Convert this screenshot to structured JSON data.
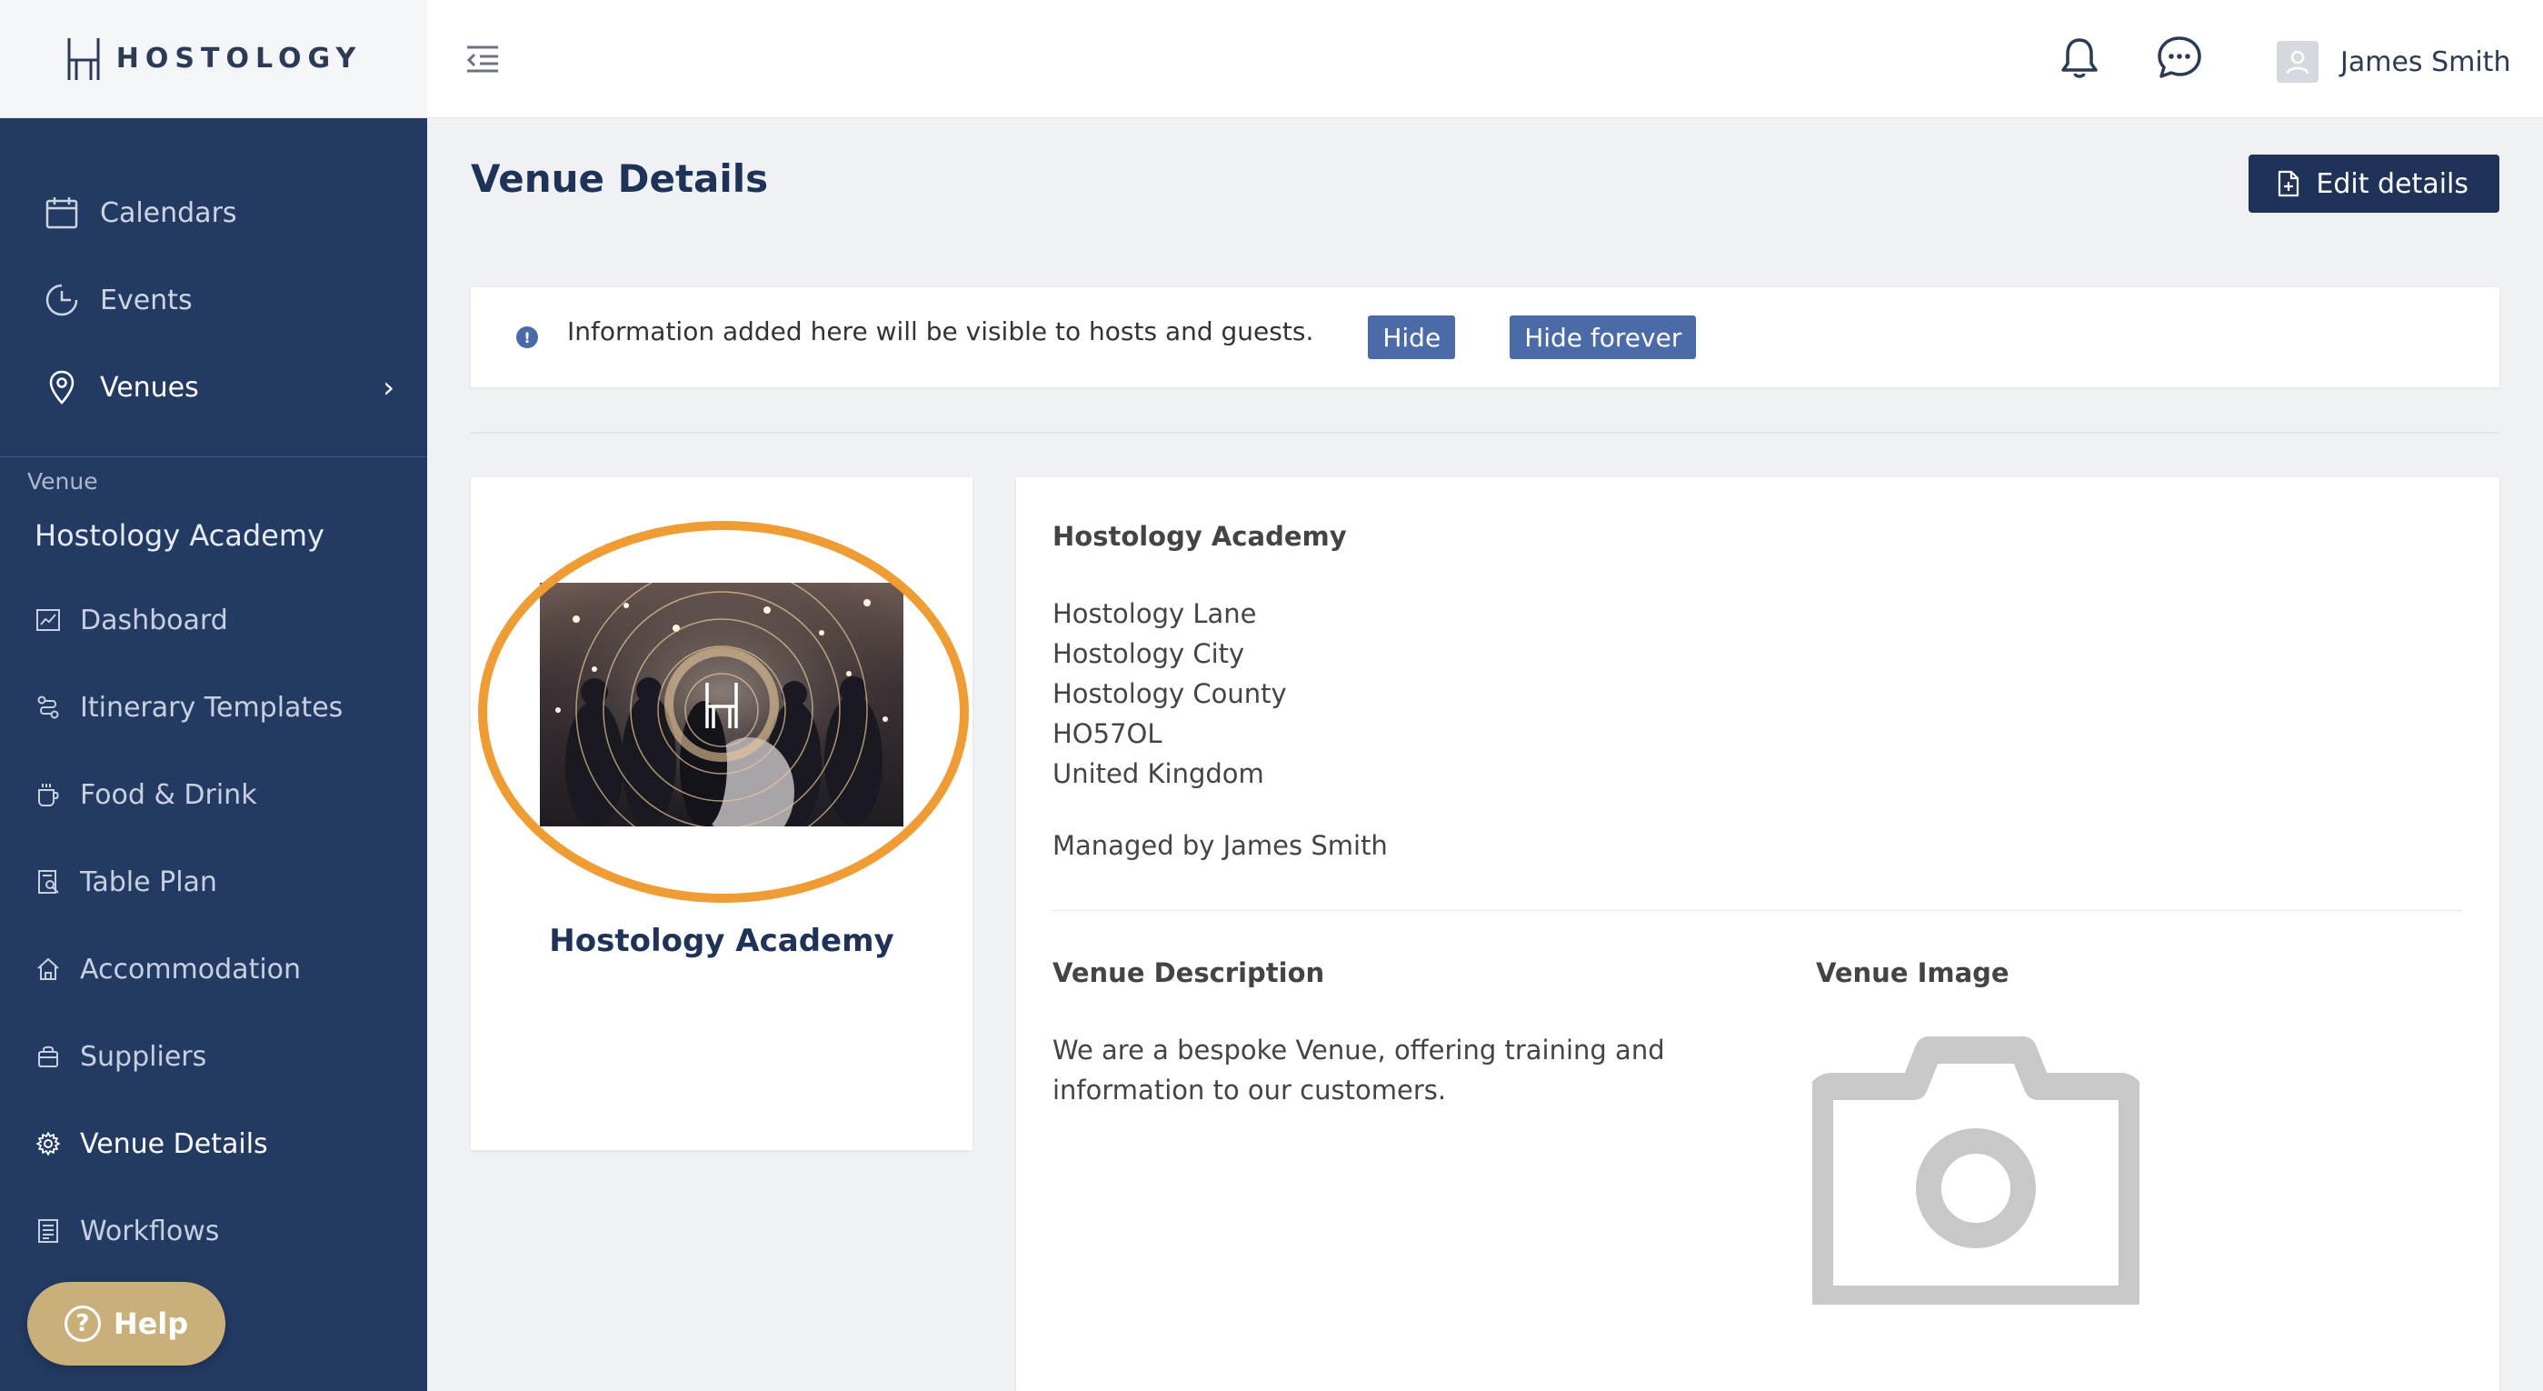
{
  "brand": {
    "name": "HOSTOLOGY"
  },
  "topbar": {
    "user_name": "James Smith",
    "icons": [
      "menu-collapse-icon",
      "bell-icon",
      "chat-icon",
      "user-avatar-icon"
    ]
  },
  "sidebar": {
    "main_items": [
      {
        "label": "Calendars",
        "icon": "calendar-icon"
      },
      {
        "label": "Events",
        "icon": "clock-icon"
      },
      {
        "label": "Venues",
        "icon": "map-pin-icon",
        "active": true
      }
    ],
    "section_label": "Venue",
    "venue_name": "Hostology Academy",
    "sub_items": [
      {
        "label": "Dashboard",
        "icon": "chart-icon"
      },
      {
        "label": "Itinerary Templates",
        "icon": "route-icon"
      },
      {
        "label": "Food & Drink",
        "icon": "cup-icon"
      },
      {
        "label": "Table Plan",
        "icon": "table-plan-icon"
      },
      {
        "label": "Accommodation",
        "icon": "home-icon"
      },
      {
        "label": "Suppliers",
        "icon": "bag-icon"
      },
      {
        "label": "Venue Details",
        "icon": "gear-icon",
        "active": true
      },
      {
        "label": "Workflows",
        "icon": "workflow-icon"
      }
    ],
    "help_label": "Help"
  },
  "main": {
    "title": "Venue Details",
    "edit_button": "Edit details",
    "info": {
      "text": "Information added here will be visible to hosts and guests.",
      "hide": "Hide",
      "hide_forever": "Hide forever"
    },
    "venue_card": {
      "title": "Hostology Academy"
    },
    "details": {
      "name": "Hostology Academy",
      "address": {
        "line1": "Hostology Lane",
        "line2": "Hostology City",
        "line3": "Hostology County",
        "postcode": "HO57OL",
        "country": "United Kingdom"
      },
      "managed_by": "Managed by James Smith",
      "description_heading": "Venue Description",
      "description": "We are a bespoke Venue, offering training and information to our customers.",
      "image_heading": "Venue Image"
    }
  },
  "colors": {
    "sidebar_bg": "#233a63",
    "primary": "#1f3258",
    "button_blue": "#4a6aa8",
    "highlight": "#f09c35",
    "help": "#c9b07a"
  }
}
